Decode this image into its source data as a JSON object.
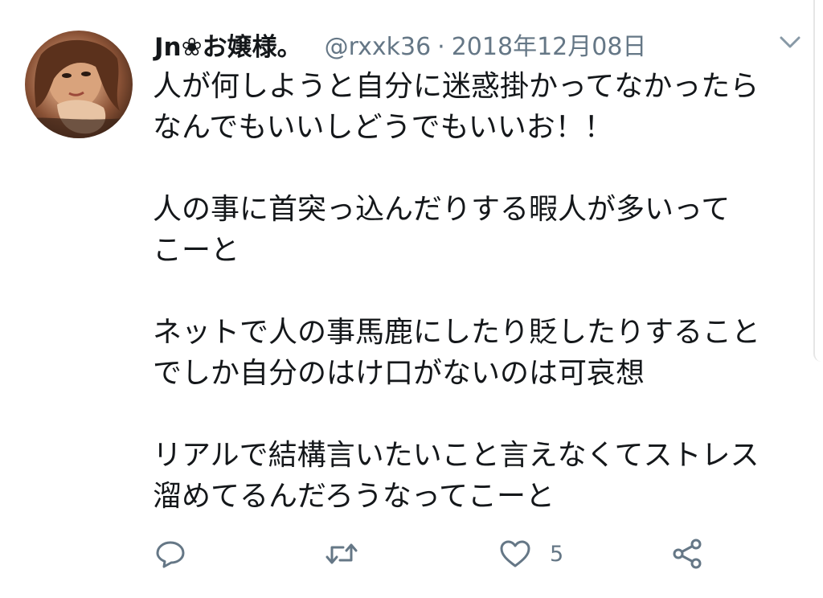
{
  "tweet": {
    "display_name": "Jn❀お嬢様。",
    "handle": "@rxxk36",
    "separator": "·",
    "date": "2018年12月08日",
    "paragraphs": [
      "人が何しようと自分に迷惑掛かってなかったら\nなんでもいいしどうでもいいお！！",
      "人の事に首突っ込んだりする暇人が多いって\nこーと",
      "ネットで人の事馬鹿にしたり貶したりすること\nでしか自分のはけ口がないのは可哀想",
      "リアルで結構言いたいこと言えなくてストレス\n溜めてるんだろうなってこーと"
    ],
    "like_count": "5"
  },
  "icons": {
    "avatar": "avatar-photo",
    "caret": "chevron-down-icon",
    "reply": "reply-icon",
    "retweet": "retweet-icon",
    "like": "heart-icon",
    "share": "share-icon"
  },
  "colors": {
    "text": "#14171a",
    "secondary": "#657786"
  }
}
